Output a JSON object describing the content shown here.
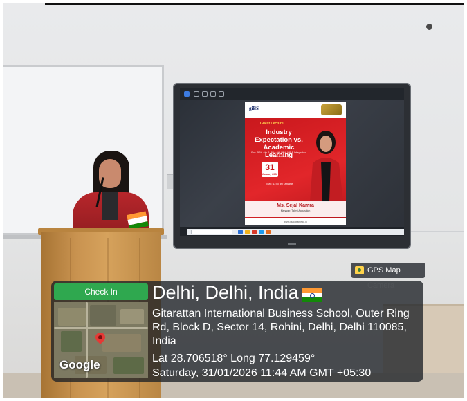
{
  "gps_overlay": {
    "check_in_label": "Check In",
    "camera_label": "GPS Map Camera",
    "city": "Delhi, Delhi, India",
    "flag_icon": "india-flag-icon",
    "address": "Gitarattan International Business School, Outer Ring Rd, Block D, Sector 14, Rohini, Delhi, Delhi 110085, India",
    "coordinates": "Lat 28.706518° Long 77.129459°",
    "datetime": "Saturday, 31/01/2026 11:44 AM GMT +05:30",
    "map_brand": "Google",
    "check_in_color": "#2fa84f"
  },
  "screen_poster": {
    "org": "giBS",
    "kicker": "Guest Lecture",
    "title": "Industry Expectation vs. Academic Learning",
    "for_line": "For: BBA 4th & BBA 6th  BBA MBA Integrated 4th Semester",
    "date_day": "31",
    "date_month": "January 2026",
    "time": "TIME: 11:00 am Onwards",
    "speaker": "Ms. Sejal Kamra",
    "speaker_role": "Manager, Talent Acquisition",
    "footer": "www.gitarattan.edu.in"
  }
}
